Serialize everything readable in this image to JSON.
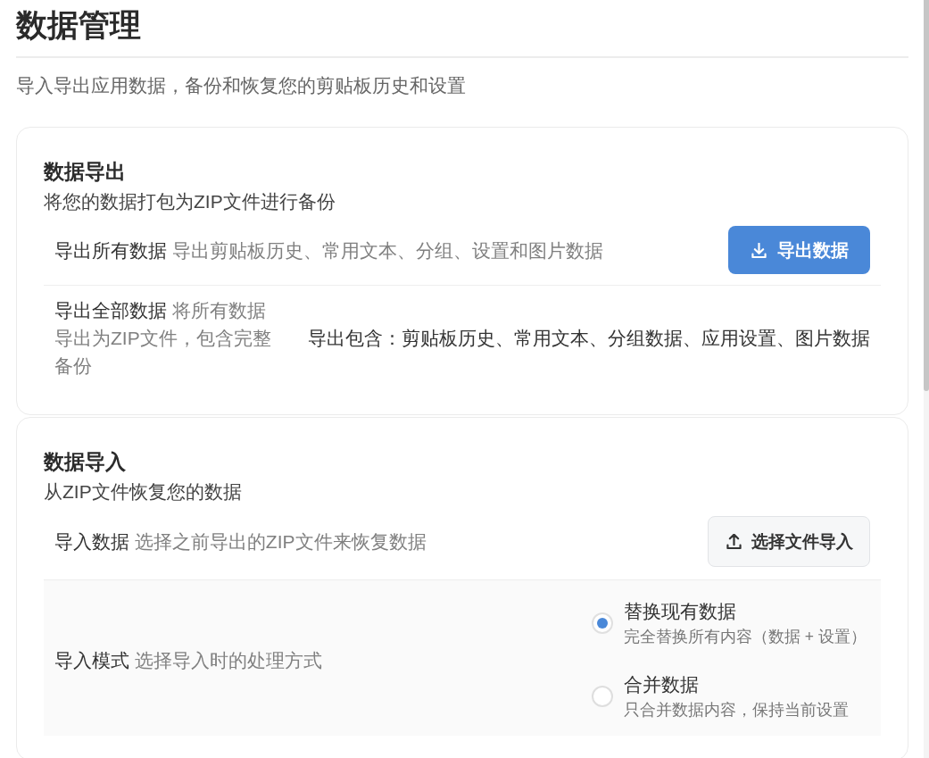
{
  "page": {
    "title": "数据管理",
    "subtitle": "导入导出应用数据，备份和恢复您的剪贴板历史和设置"
  },
  "sections": [
    {
      "title": "数据导出",
      "subtitle": "将您的数据打包为ZIP文件进行备份",
      "rows": [
        {
          "kind": "action",
          "label": "导出所有数据",
          "description": "导出剪贴板历史、常用文本、分组、设置和图片数据",
          "button": {
            "kind": "primary",
            "label": "导出数据"
          }
        },
        {
          "kind": "info",
          "label": "导出全部数据",
          "description": "将所有数据导出为ZIP文件，包含完整备份",
          "note": "导出包含：剪贴板历史、常用文本、分组数据、应用设置、图片数据"
        }
      ]
    },
    {
      "title": "数据导入",
      "subtitle": "从ZIP文件恢复您的数据",
      "rows": [
        {
          "kind": "action",
          "label": "导入数据",
          "description": "选择之前导出的ZIP文件来恢复数据",
          "button": {
            "kind": "secondary",
            "label": "选择文件导入"
          }
        },
        {
          "kind": "choice",
          "label": "导入模式",
          "description": "选择导入时的处理方式",
          "options": [
            {
              "label": "替换现有数据",
              "description": "完全替换所有内容（数据 + 设置）",
              "selected": true
            },
            {
              "label": "合并数据",
              "description": "只合并数据内容，保持当前设置",
              "selected": false
            }
          ]
        }
      ]
    }
  ]
}
